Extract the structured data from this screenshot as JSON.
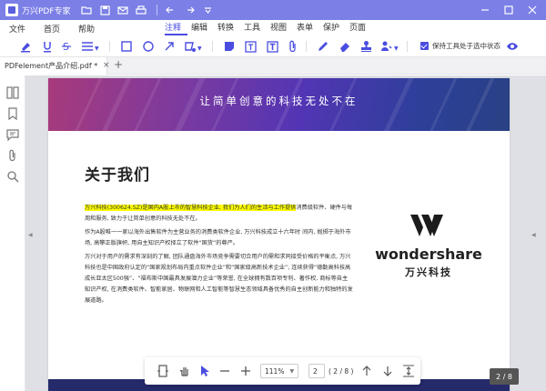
{
  "window": {
    "title": "万兴PDF专家"
  },
  "menu": {
    "left": [
      "文件",
      "首页",
      "帮助"
    ],
    "tabs": [
      "注释",
      "编辑",
      "转换",
      "工具",
      "视图",
      "表单",
      "保护",
      "页面"
    ],
    "active_tab": "注释"
  },
  "toolbar": {
    "keep_tool_label": "保持工具处于选中状态",
    "keep_tool_checked": true
  },
  "tab": {
    "filename": "PDFelement产品介绍.pdf *"
  },
  "document": {
    "banner_text": "让简单创意的科技无处不在",
    "heading": "关于我们",
    "paragraphs": [
      {
        "highlight": "万兴科技(300624.SZ)是国内A股上市的智慧科技企业, 我们为人们的生活与工作提供",
        "rest": "消费级软件、硬件与每周和服务, 致力于让简单创意的科技无处不在。"
      },
      {
        "highlight": "",
        "rest": "作为A股唯一一家以海外出售软件为主营业务的消费类软件企业, 万兴科技成立十六年时 间内, 抛掷于海外市场, 高攀正版旗帜, 用自主知识产权择立了软件“国货”的尊严。"
      },
      {
        "highlight": "",
        "rest": "万兴对于用户的需求有深刻的了解, 团队通盘海外市场竞争需要切合用户的需和求同接受价格的平衡点, 万兴科技也是中国政府认定的“国家规划布局内重点软件企业”和“国家级高新技术企业”, 连续获得“德勤高科技高成长亚太区500强”、“福布斯中国最具发展潜力企业”等荣誉, 在全球拥有数百项专利、著作权, 商标等自主知识产权, 在消费类软件、智能家居、物联网和人工智能等智慧生态领域具备优秀的自主创新能力和独特的发展道路。"
      }
    ],
    "logo_name": "wondershare",
    "logo_cn": "万兴科技"
  },
  "nav": {
    "zoom": "111%",
    "page_input": "2",
    "page_total": "( 2 / 8 )",
    "page_badge": "2 / 8"
  },
  "colors": {
    "accent": "#4a4de0",
    "titlebar": "#7b7fe6",
    "highlight": "#ffff00"
  }
}
